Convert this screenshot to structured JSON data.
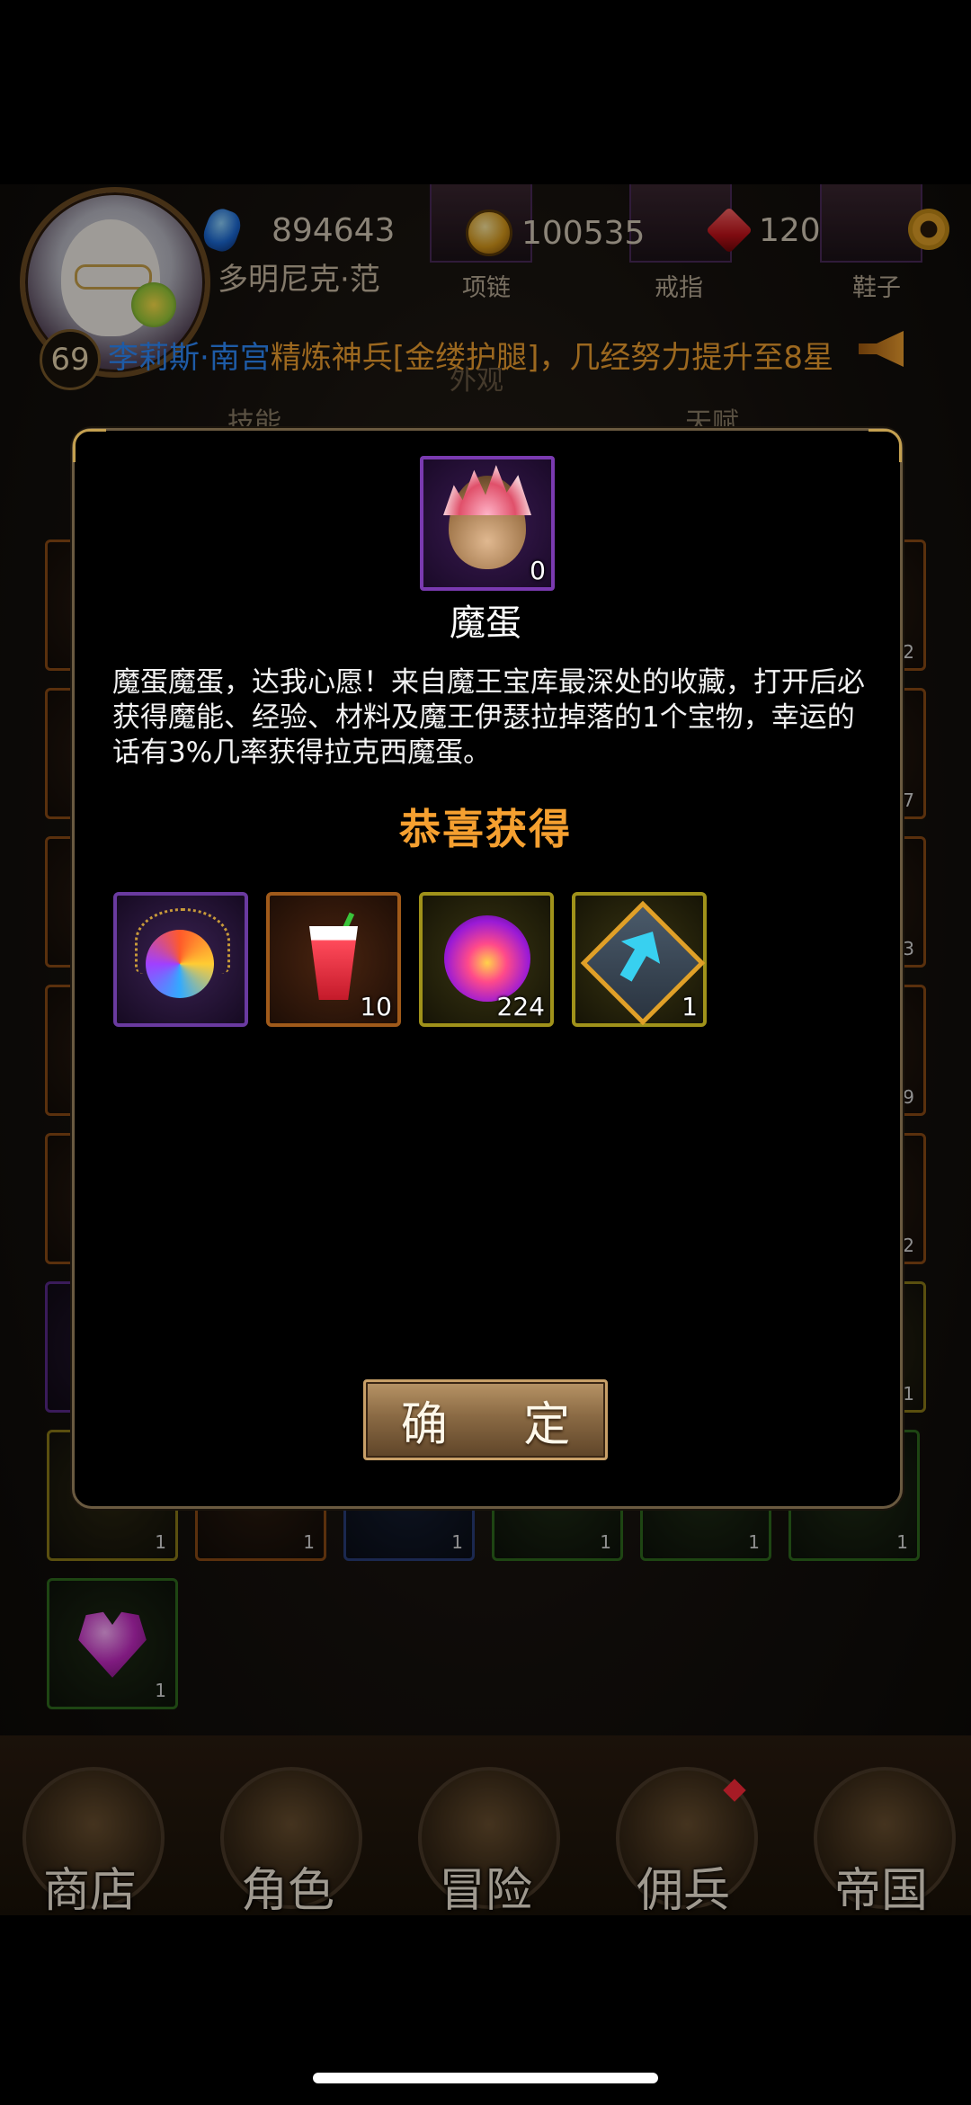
{
  "player": {
    "name": "多明尼克·范",
    "level": "69",
    "sapphire": "894643",
    "gold": "100535",
    "ruby": "120"
  },
  "equipment": {
    "necklace_label": "项链",
    "ring_label": "戒指",
    "shoes_label": "鞋子"
  },
  "broadcast": {
    "name": "李莉斯·南宫",
    "text": "精炼神兵[金缕护腿]，几经努力提升至8星"
  },
  "behind_tabs": {
    "skill": "技能",
    "appearance": "外观",
    "talent": "天赋"
  },
  "bag": {
    "counts": [
      "2",
      "7",
      "3",
      "9",
      "2",
      "1",
      "1",
      "1",
      "1",
      "1",
      "1",
      "1",
      "1"
    ]
  },
  "modal": {
    "item_name": "魔蛋",
    "item_qty": "0",
    "description": "魔蛋魔蛋，达我心愿！来自魔王宝库最深处的收藏，打开后必获得魔能、经验、材料及魔王伊瑟拉掉落的1个宝物，幸运的话有3%几率获得拉克西魔蛋。",
    "congrats": "恭喜获得",
    "rewards": [
      {
        "icon": "amulet-icon",
        "qty": "",
        "rarity_color": "#6a3aa0"
      },
      {
        "icon": "drink-icon",
        "qty": "10",
        "rarity_color": "#a05a1a"
      },
      {
        "icon": "fire-orb-icon",
        "qty": "224",
        "rarity_color": "#a0921a"
      },
      {
        "icon": "upgrade-icon",
        "qty": "1",
        "rarity_color": "#a0921a"
      }
    ],
    "confirm_label": "确 定"
  },
  "nav": {
    "shop": "商店",
    "character": "角色",
    "adventure": "冒险",
    "mercenary": "佣兵",
    "empire": "帝国"
  },
  "colors": {
    "accent_orange": "#f5a030",
    "broadcast_blue": "#2f8cff",
    "modal_bg": "#000000"
  }
}
